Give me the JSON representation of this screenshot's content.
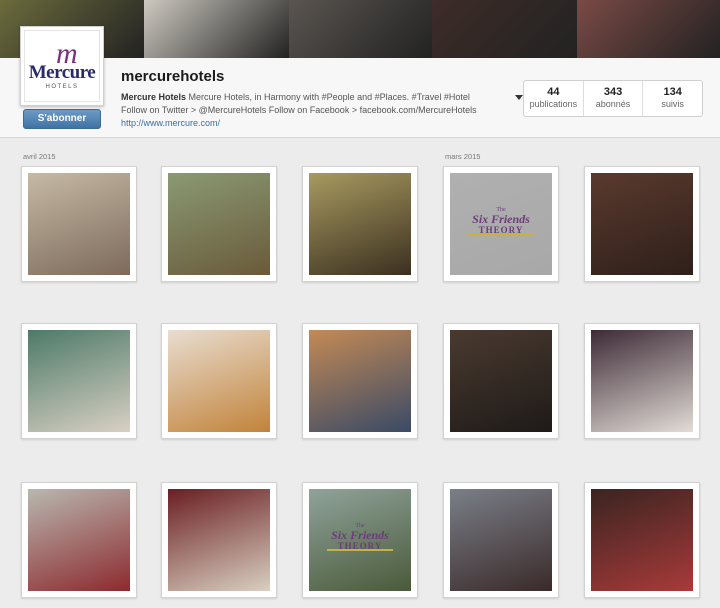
{
  "banner": {
    "tiles": [
      {
        "name": "banner-photo-lawn",
        "color": "#6b6b3c"
      },
      {
        "name": "banner-photo-chef",
        "color": "#cdc9c0"
      },
      {
        "name": "banner-photo-salad",
        "color": "#5a5550"
      },
      {
        "name": "banner-photo-friends",
        "color": "#3e2c28"
      },
      {
        "name": "banner-photo-selfie",
        "color": "#7a4a45"
      }
    ]
  },
  "profile": {
    "logo": {
      "word": "Mercure",
      "sub": "HOTELS",
      "mark": "m"
    },
    "follow_button": "S'abonner",
    "username": "mercurehotels",
    "bio_name": "Mercure Hotels",
    "bio_line1": " Mercure Hotels, in Harmony with #People and #Places. #Travel #Hotel",
    "bio_line2": "Follow on Twitter > @MercureHotels Follow on Facebook > facebook.com/MercureHotels",
    "link": "http://www.mercure.com/",
    "stats": [
      {
        "value": "44",
        "label": "publications"
      },
      {
        "value": "343",
        "label": "abonnés"
      },
      {
        "value": "134",
        "label": "suivis"
      }
    ]
  },
  "months": {
    "first": "avril 2015",
    "second": "mars 2015"
  },
  "photos": [
    {
      "name": "photo-hotel-room-women",
      "colors": [
        "#c6b9a6",
        "#7d6a5a"
      ]
    },
    {
      "name": "photo-savanna-landscape",
      "colors": [
        "#8a9a73",
        "#6a5a3a"
      ]
    },
    {
      "name": "photo-safari-selfie",
      "colors": [
        "#a89a60",
        "#3b3020"
      ]
    },
    {
      "name": "photo-six-friends-theory-logo",
      "colors": [
        "#b0b0b0",
        "#a8a8a8"
      ],
      "caption_top": "The",
      "caption_main": "Six Friends",
      "caption_sub": "THEORY"
    },
    {
      "name": "photo-friends-group-selfie",
      "colors": [
        "#5a3a2e",
        "#2e1f1a"
      ]
    },
    {
      "name": "photo-receptionist-smiling",
      "colors": [
        "#4d7a68",
        "#d8d0c4"
      ]
    },
    {
      "name": "photo-breakfast-tray",
      "colors": [
        "#e8ddd0",
        "#c2833a"
      ]
    },
    {
      "name": "photo-airplane-window",
      "colors": [
        "#c48a55",
        "#3a4a66"
      ]
    },
    {
      "name": "photo-concierge-desk",
      "colors": [
        "#4a3a30",
        "#1e1a18"
      ]
    },
    {
      "name": "photo-chef-chalkboard",
      "colors": [
        "#3d2a36",
        "#e2dcd6"
      ]
    },
    {
      "name": "photo-paris-selfie",
      "colors": [
        "#b9b7b0",
        "#8c2a2e"
      ]
    },
    {
      "name": "photo-room-keycard",
      "colors": [
        "#6a1e22",
        "#d8cfc0"
      ]
    },
    {
      "name": "photo-six-friends-landscape",
      "colors": [
        "#8fa39a",
        "#4a5a3a"
      ],
      "caption_top": "The",
      "caption_main": "Six Friends",
      "caption_sub": "THEORY"
    },
    {
      "name": "photo-car-selfie",
      "colors": [
        "#7a7f88",
        "#3a2a2a"
      ]
    },
    {
      "name": "photo-bar-table",
      "colors": [
        "#3a2420",
        "#a83a3a"
      ]
    }
  ]
}
